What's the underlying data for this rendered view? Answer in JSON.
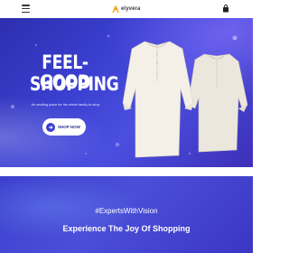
{
  "header": {
    "logo_text": "elyvera",
    "menu_icon": "hamburger-icon",
    "cart_icon": "shopping-bag-icon"
  },
  "hero": {
    "title_line1": "FEEL-GOOD",
    "title_line2": "SHOPPING",
    "subtitle": "An exciting place for the whole family to shop",
    "cta_label": "SHOP NOW",
    "cta_icon": "arrow-right-icon",
    "image": "two cream linen kurta shirts",
    "colors": {
      "hero_bg": "#3a3fd0",
      "cta_bg": "#ffffff",
      "accent": "#3b3fcf"
    }
  },
  "section2": {
    "hashtag": "#ExpertsWithVision",
    "tagline": "Experience The Joy Of Shopping"
  }
}
